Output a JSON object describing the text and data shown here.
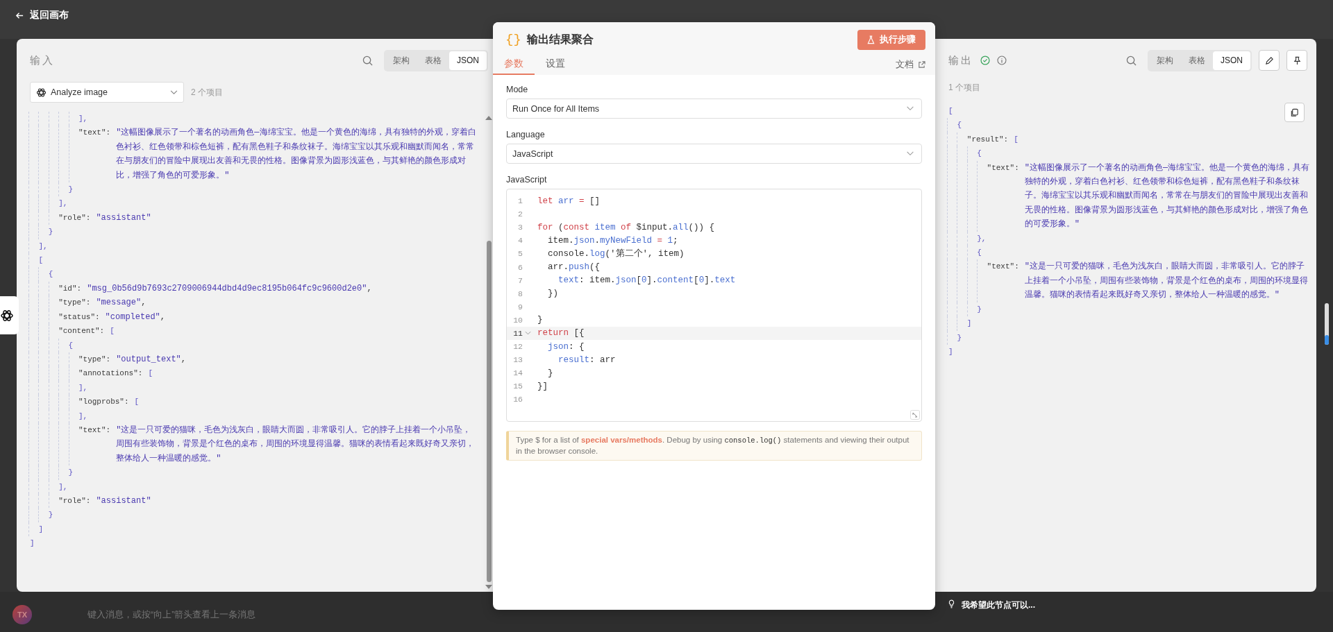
{
  "top_bar": {
    "back_label": "返回画布"
  },
  "input_panel": {
    "title": "输入",
    "views": [
      {
        "label": "架构",
        "selected": false
      },
      {
        "label": "表格",
        "selected": false
      },
      {
        "label": "JSON",
        "selected": true
      }
    ],
    "node_select": {
      "value": "Analyze image"
    },
    "item_count": "2 个项目",
    "tree": {
      "kind": "branch",
      "close": "]",
      "children": [
        {
          "kind": "branch",
          "close": "],",
          "children": [
            {
              "kind": "branch",
              "close": "}",
              "children": [
                {
                  "kind": "branch",
                  "close": "],",
                  "children": [
                    {
                      "kind": "branch",
                      "close": "}",
                      "children": [
                        {
                          "kind": "branch",
                          "close": "],"
                        },
                        {
                          "kind": "leaf",
                          "key": "\"text\":",
                          "value": "\"这幅图像展示了一个著名的动画角色—海绵宝宝。他是一个黄色的海绵，具有独特的外观，穿着白色衬衫、红色领带和棕色短裤，配有黑色鞋子和条纹袜子。海绵宝宝以其乐观和幽默而闻名，常常在与朋友们的冒险中展现出友善和无畏的性格。图像背景为圆形浅蓝色，与其鲜艳的颜色形成对比，增强了角色的可爱形象。\""
                        }
                      ]
                    }
                  ]
                },
                {
                  "kind": "leaf",
                  "key": "\"role\":",
                  "value": "\"assistant\""
                }
              ]
            }
          ]
        },
        {
          "kind": "branch",
          "open": {
            "bracket": "["
          },
          "close": "]",
          "children": [
            {
              "kind": "branch",
              "open": {
                "bracket": "{"
              },
              "close": "}",
              "children": [
                {
                  "kind": "leaf",
                  "key": "\"id\":",
                  "value": "\"msg_0b56d9b7693c2709006944dbd4d9ec8195b064fc9c9600d2e0\"",
                  "after": ","
                },
                {
                  "kind": "leaf",
                  "key": "\"type\":",
                  "value": "\"message\"",
                  "after": ","
                },
                {
                  "kind": "leaf",
                  "key": "\"status\":",
                  "value": "\"completed\"",
                  "after": ","
                },
                {
                  "kind": "branch",
                  "open": {
                    "key": "\"content\":",
                    "bracket": "["
                  },
                  "close": "],",
                  "children": [
                    {
                      "kind": "branch",
                      "open": {
                        "bracket": "{"
                      },
                      "close": "}",
                      "children": [
                        {
                          "kind": "leaf",
                          "key": "\"type\":",
                          "value": "\"output_text\"",
                          "after": ","
                        },
                        {
                          "kind": "branch",
                          "open": {
                            "key": "\"annotations\":",
                            "bracket": "["
                          },
                          "close": "],"
                        },
                        {
                          "kind": "branch",
                          "open": {
                            "key": "\"logprobs\":",
                            "bracket": "["
                          },
                          "close": "],"
                        },
                        {
                          "kind": "leaf",
                          "key": "\"text\":",
                          "value": "\"这是一只可爱的猫咪，毛色为浅灰白，眼睛大而圆，非常吸引人。它的脖子上挂着一个小吊坠，周围有些装饰物，背景是个红色的桌布，周围的环境显得温馨。猫咪的表情看起来既好奇又亲切，整体给人一种温暖的感觉。\""
                        }
                      ]
                    }
                  ]
                },
                {
                  "kind": "leaf",
                  "key": "\"role\":",
                  "value": "\"assistant\""
                }
              ]
            }
          ]
        }
      ]
    }
  },
  "node_panel": {
    "icon_glyph": "{}",
    "title": "输出结果聚合",
    "run_button": "执行步骤",
    "tabs": [
      {
        "label": "参数",
        "selected": true
      },
      {
        "label": "设置",
        "selected": false
      }
    ],
    "docs_link": "文档",
    "fields": [
      {
        "label": "Mode",
        "value": "Run Once for All Items"
      },
      {
        "label": "Language",
        "value": "JavaScript"
      }
    ],
    "editor": {
      "label": "JavaScript",
      "lines": [
        {
          "number": "1",
          "active": false,
          "foldable": false,
          "tokens": [
            {
              "kind": "keyword",
              "text": "let"
            },
            {
              "kind": "name",
              "text": " arr"
            },
            {
              "kind": "keyword",
              "text": " ="
            },
            {
              "kind": "plain",
              "text": " []"
            }
          ]
        },
        {
          "number": "2",
          "active": false,
          "foldable": false
        },
        {
          "number": "3",
          "active": false,
          "foldable": false,
          "tokens": [
            {
              "kind": "keyword",
              "text": "for"
            },
            {
              "kind": "plain",
              "text": " ("
            },
            {
              "kind": "keyword",
              "text": "const"
            },
            {
              "kind": "name",
              "text": " item"
            },
            {
              "kind": "keyword",
              "text": " of"
            },
            {
              "kind": "plain",
              "text": " $input."
            },
            {
              "kind": "name",
              "text": "all"
            },
            {
              "kind": "plain",
              "text": "()) {"
            }
          ]
        },
        {
          "number": "4",
          "active": false,
          "foldable": false,
          "tokens": [
            {
              "kind": "plain",
              "text": "  item."
            },
            {
              "kind": "name",
              "text": "json"
            },
            {
              "kind": "plain",
              "text": "."
            },
            {
              "kind": "name",
              "text": "myNewField"
            },
            {
              "kind": "keyword",
              "text": " ="
            },
            {
              "kind": "name",
              "text": " 1"
            },
            {
              "kind": "plain",
              "text": ";"
            }
          ]
        },
        {
          "number": "5",
          "active": false,
          "foldable": false,
          "tokens": [
            {
              "kind": "plain",
              "text": "  console."
            },
            {
              "kind": "name",
              "text": "log"
            },
            {
              "kind": "plain",
              "text": "('第二个', item)"
            }
          ]
        },
        {
          "number": "6",
          "active": false,
          "foldable": false,
          "tokens": [
            {
              "kind": "plain",
              "text": "  arr."
            },
            {
              "kind": "name",
              "text": "push"
            },
            {
              "kind": "plain",
              "text": "({"
            }
          ]
        },
        {
          "number": "7",
          "active": false,
          "foldable": false,
          "tokens": [
            {
              "kind": "name",
              "text": "    text"
            },
            {
              "kind": "plain",
              "text": ": item."
            },
            {
              "kind": "name",
              "text": "json"
            },
            {
              "kind": "plain",
              "text": "["
            },
            {
              "kind": "name",
              "text": "0"
            },
            {
              "kind": "plain",
              "text": "]."
            },
            {
              "kind": "name",
              "text": "content"
            },
            {
              "kind": "plain",
              "text": "["
            },
            {
              "kind": "name",
              "text": "0"
            },
            {
              "kind": "plain",
              "text": "]."
            },
            {
              "kind": "name",
              "text": "text"
            }
          ]
        },
        {
          "number": "8",
          "active": false,
          "foldable": false,
          "tokens": [
            {
              "kind": "plain",
              "text": "  })"
            }
          ]
        },
        {
          "number": "9",
          "active": false,
          "foldable": false
        },
        {
          "number": "10",
          "active": false,
          "foldable": false,
          "tokens": [
            {
              "kind": "plain",
              "text": "}"
            }
          ]
        },
        {
          "number": "11",
          "active": true,
          "foldable": true,
          "tokens": [
            {
              "kind": "keyword",
              "text": "return"
            },
            {
              "kind": "plain",
              "text": " [{"
            }
          ]
        },
        {
          "number": "12",
          "active": false,
          "foldable": false,
          "tokens": [
            {
              "kind": "name",
              "text": "  json"
            },
            {
              "kind": "plain",
              "text": ": {"
            }
          ]
        },
        {
          "number": "13",
          "active": false,
          "foldable": false,
          "tokens": [
            {
              "kind": "name",
              "text": "    result"
            },
            {
              "kind": "plain",
              "text": ": arr"
            }
          ]
        },
        {
          "number": "14",
          "active": false,
          "foldable": false,
          "tokens": [
            {
              "kind": "plain",
              "text": "  }"
            }
          ]
        },
        {
          "number": "15",
          "active": false,
          "foldable": false,
          "tokens": [
            {
              "kind": "plain",
              "text": "}]"
            }
          ]
        },
        {
          "number": "16",
          "active": false,
          "foldable": false
        }
      ]
    },
    "hint": [
      {
        "kind": "plain",
        "text": "Type $ for a list of "
      },
      {
        "kind": "link",
        "text": "special vars/methods"
      },
      {
        "kind": "plain",
        "text": ". Debug by using "
      },
      {
        "kind": "code",
        "text": "console.log()"
      },
      {
        "kind": "plain",
        "text": " statements and viewing their output in the browser console."
      }
    ]
  },
  "output_panel": {
    "title": "输出",
    "views": [
      {
        "label": "架构",
        "selected": false
      },
      {
        "label": "表格",
        "selected": false
      },
      {
        "label": "JSON",
        "selected": true
      }
    ],
    "item_count": "1 个项目",
    "tree": {
      "kind": "branch",
      "open": {
        "bracket": "["
      },
      "close": "]",
      "children": [
        {
          "kind": "branch",
          "open": {
            "bracket": "{"
          },
          "close": "}",
          "children": [
            {
              "kind": "branch",
              "open": {
                "key": "\"result\":",
                "bracket": "["
              },
              "close": "]",
              "children": [
                {
                  "kind": "branch",
                  "open": {
                    "bracket": "{"
                  },
                  "close": "},",
                  "children": [
                    {
                      "kind": "leaf",
                      "key": "\"text\":",
                      "value": "\"这幅图像展示了一个著名的动画角色—海绵宝宝。他是一个黄色的海绵，具有独特的外观，穿着白色衬衫、红色领带和棕色短裤，配有黑色鞋子和条纹袜子。海绵宝宝以其乐观和幽默而闻名，常常在与朋友们的冒险中展现出友善和无畏的性格。图像背景为圆形浅蓝色，与其鲜艳的颜色形成对比，增强了角色的可爱形象。\""
                    }
                  ]
                },
                {
                  "kind": "branch",
                  "open": {
                    "bracket": "{"
                  },
                  "close": "}",
                  "children": [
                    {
                      "kind": "leaf",
                      "key": "\"text\":",
                      "value": "\"这是一只可爱的猫咪，毛色为浅灰白，眼睛大而圆，非常吸引人。它的脖子上挂着一个小吊坠，周围有些装饰物，背景是个红色的桌布，周围的环境显得温馨。猫咪的表情看起来既好奇又亲切，整体给人一种温暖的感觉。\""
                    }
                  ]
                }
              ]
            }
          ]
        }
      ]
    }
  },
  "chat": {
    "avatar": "TX",
    "placeholder": "键入消息，或按“向上”箭头查看上一条消息",
    "suggestion": "我希望此节点可以..."
  }
}
